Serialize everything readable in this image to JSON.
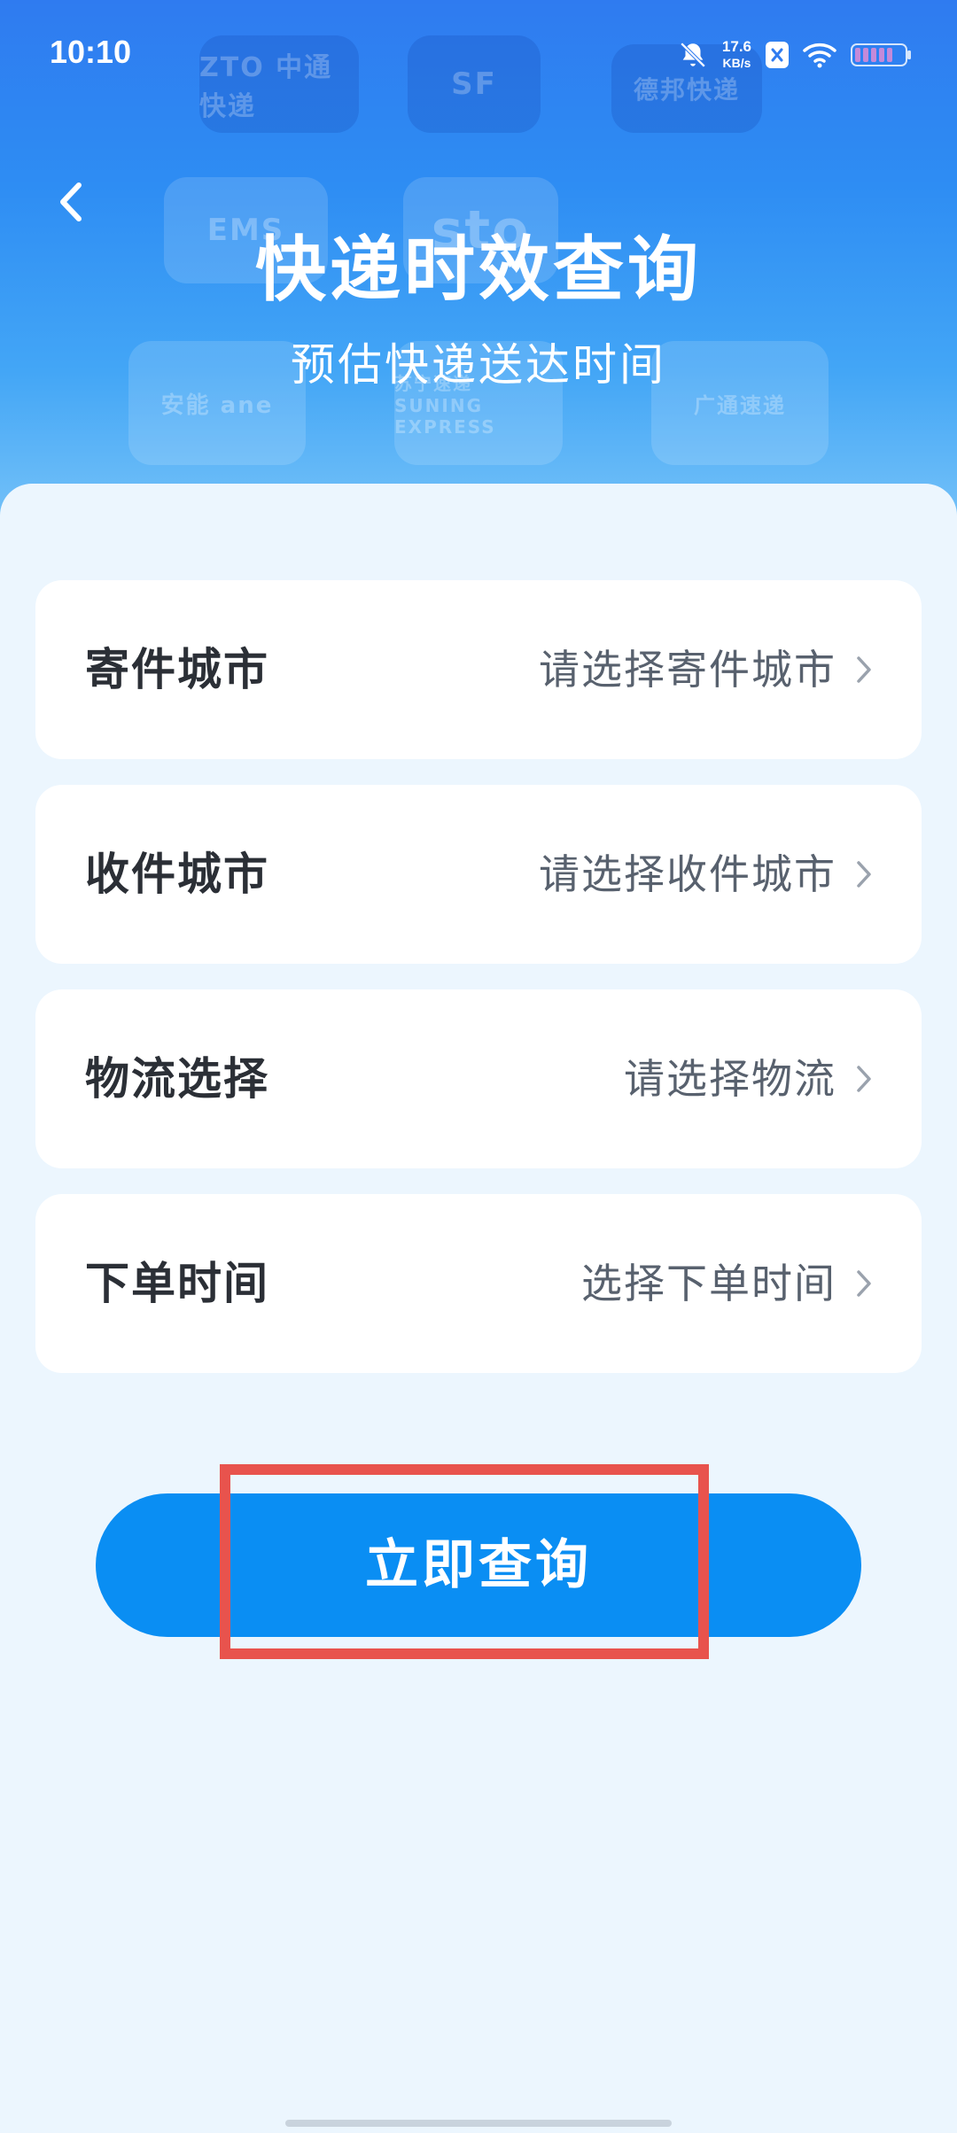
{
  "status_bar": {
    "time": "10:10",
    "net_speed_value": "17.6",
    "net_speed_unit": "KB/s",
    "icons": [
      "bell-mute-icon",
      "x-app-icon",
      "wifi-icon",
      "battery-icon"
    ]
  },
  "hero": {
    "title": "快递时效查询",
    "subtitle": "预估快递送达时间",
    "brand_tiles": [
      "ZTO 中通快递",
      "SF",
      "德邦快递",
      "EMS",
      "sto",
      "安能 ane",
      "苏宁速递 SUNING EXPRESS",
      "广通速递"
    ]
  },
  "form": {
    "rows": [
      {
        "label": "寄件城市",
        "value": "请选择寄件城市"
      },
      {
        "label": "收件城市",
        "value": "请选择收件城市"
      },
      {
        "label": "物流选择",
        "value": "请选择物流"
      },
      {
        "label": "下单时间",
        "value": "选择下单时间"
      }
    ]
  },
  "actions": {
    "query_label": "立即查询"
  },
  "colors": {
    "primary": "#0A8EF3",
    "highlight": "#E8534D",
    "background": "#ECF6FE"
  }
}
